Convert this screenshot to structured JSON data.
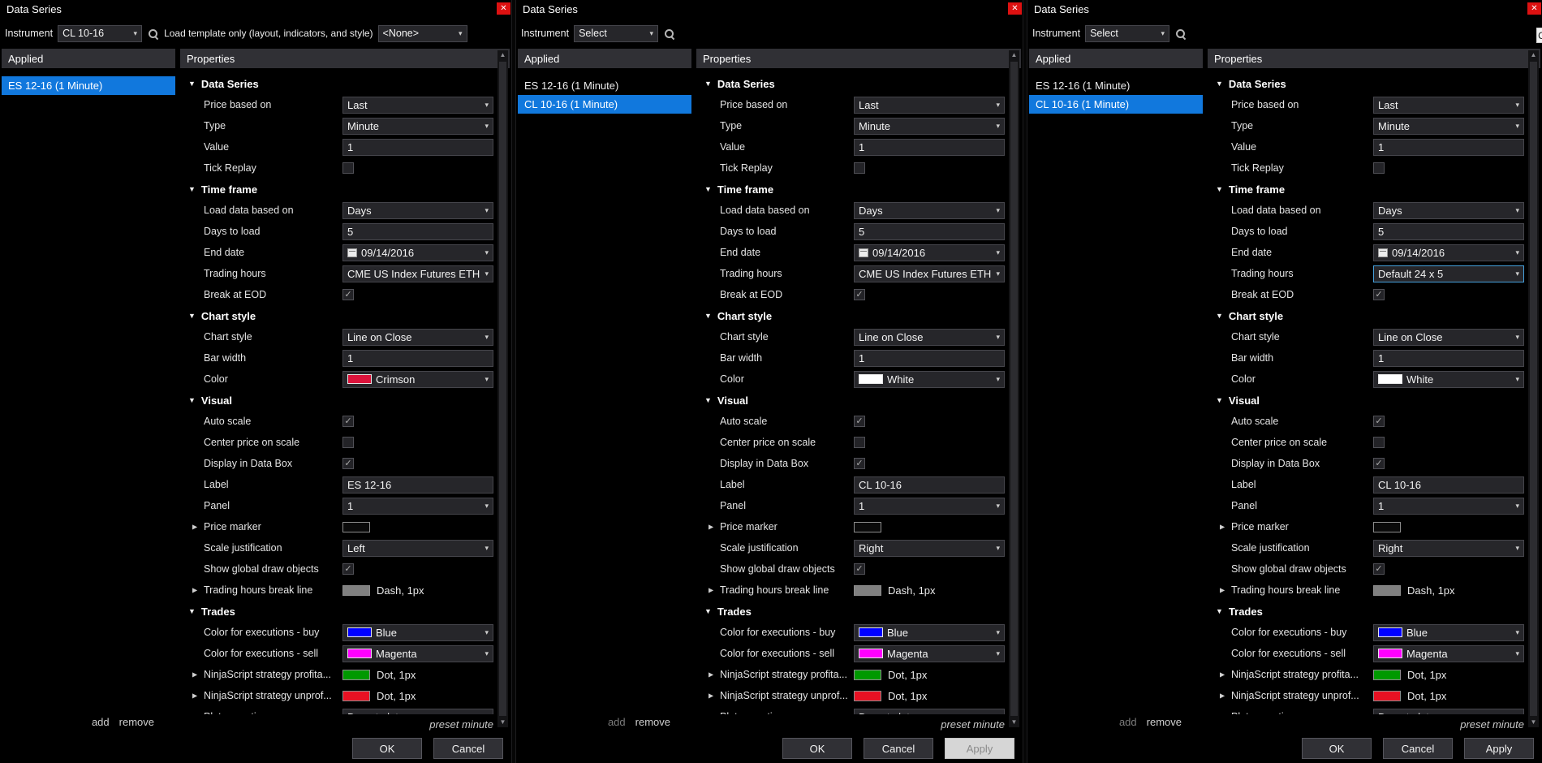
{
  "ui": {
    "close_glyph": "✕",
    "chevron": "▾",
    "category_arrow": "▼",
    "expand_arrow": "▶",
    "check_glyph": "✓",
    "arrow_up": "▲",
    "arrow_down": "▼"
  },
  "fragment": {
    "label": "C"
  },
  "dialogs": [
    {
      "title": "Data Series",
      "toolbar": {
        "instrument_label": "Instrument",
        "instrument_value": "CL 10-16",
        "template_label": "Load template only (layout, indicators, and style)",
        "template_value": "<None>"
      },
      "applied_header": "Applied",
      "applied_items": [
        {
          "label": "ES 12-16 (1 Minute)",
          "selected": true
        }
      ],
      "properties_header": "Properties",
      "groups": [
        {
          "label": "Data Series",
          "rows": [
            {
              "label": "Price based on",
              "type": "select",
              "value": "Last"
            },
            {
              "label": "Type",
              "type": "select",
              "value": "Minute"
            },
            {
              "label": "Value",
              "type": "input",
              "value": "1"
            },
            {
              "label": "Tick Replay",
              "type": "checkbox",
              "checked": false
            }
          ]
        },
        {
          "label": "Time frame",
          "rows": [
            {
              "label": "Load data based on",
              "type": "select",
              "value": "Days"
            },
            {
              "label": "Days to load",
              "type": "input",
              "value": "5"
            },
            {
              "label": "End date",
              "type": "date",
              "value": "09/14/2016"
            },
            {
              "label": "Trading hours",
              "type": "select",
              "value": "CME US Index Futures ETH"
            },
            {
              "label": "Break at EOD",
              "type": "checkbox",
              "checked": true
            }
          ]
        },
        {
          "label": "Chart style",
          "rows": [
            {
              "label": "Chart style",
              "type": "select",
              "value": "Line on Close"
            },
            {
              "label": "Bar width",
              "type": "input",
              "value": "1"
            },
            {
              "label": "Color",
              "type": "colorselect",
              "value": "Crimson",
              "color": "#DC143C"
            }
          ]
        },
        {
          "label": "Visual",
          "rows": [
            {
              "label": "Auto scale",
              "type": "checkbox",
              "checked": true
            },
            {
              "label": "Center price on scale",
              "type": "checkbox",
              "checked": false
            },
            {
              "label": "Display in Data Box",
              "type": "checkbox",
              "checked": true
            },
            {
              "label": "Label",
              "type": "input",
              "value": "ES 12-16"
            },
            {
              "label": "Panel",
              "type": "select",
              "value": "1"
            },
            {
              "label": "Price marker",
              "type": "swatch",
              "color": "#0a0a0a",
              "expandable": true
            },
            {
              "label": "Scale justification",
              "type": "select",
              "value": "Left"
            },
            {
              "label": "Show global draw objects",
              "type": "checkbox",
              "checked": true
            },
            {
              "label": "Trading hours break line",
              "type": "lineswatch",
              "value": "Dash, 1px",
              "color": "#808080",
              "expandable": true
            }
          ]
        },
        {
          "label": "Trades",
          "rows": [
            {
              "label": "Color for executions - buy",
              "type": "colorselect",
              "value": "Blue",
              "color": "#0000FF"
            },
            {
              "label": "Color for executions - sell",
              "type": "colorselect",
              "value": "Magenta",
              "color": "#FF00FF"
            },
            {
              "label": "NinjaScript strategy profita...",
              "type": "lineswatch",
              "value": "Dot, 1px",
              "color": "#009900",
              "expandable": true
            },
            {
              "label": "NinjaScript strategy unprof...",
              "type": "lineswatch",
              "value": "Dot, 1px",
              "color": "#E81123",
              "expandable": true
            },
            {
              "label": "Plot executions",
              "type": "select",
              "value": "Do not plot"
            }
          ]
        }
      ],
      "footer": {
        "add": "add",
        "remove": "remove",
        "add_enabled": true,
        "preset": "preset minute"
      },
      "buttons": [
        {
          "label": "OK",
          "disabled": false
        },
        {
          "label": "Cancel",
          "disabled": false
        }
      ]
    },
    {
      "title": "Data Series",
      "toolbar": {
        "instrument_label": "Instrument",
        "instrument_value": "Select"
      },
      "applied_header": "Applied",
      "applied_items": [
        {
          "label": "ES 12-16 (1 Minute)",
          "selected": false
        },
        {
          "label": "CL 10-16 (1 Minute)",
          "selected": true
        }
      ],
      "properties_header": "Properties",
      "groups": [
        {
          "label": "Data Series",
          "rows": [
            {
              "label": "Price based on",
              "type": "select",
              "value": "Last"
            },
            {
              "label": "Type",
              "type": "select",
              "value": "Minute"
            },
            {
              "label": "Value",
              "type": "input",
              "value": "1"
            },
            {
              "label": "Tick Replay",
              "type": "checkbox",
              "checked": false
            }
          ]
        },
        {
          "label": "Time frame",
          "rows": [
            {
              "label": "Load data based on",
              "type": "select",
              "value": "Days"
            },
            {
              "label": "Days to load",
              "type": "input",
              "value": "5"
            },
            {
              "label": "End date",
              "type": "date",
              "value": "09/14/2016"
            },
            {
              "label": "Trading hours",
              "type": "select",
              "value": "CME US Index Futures ETH"
            },
            {
              "label": "Break at EOD",
              "type": "checkbox",
              "checked": true
            }
          ]
        },
        {
          "label": "Chart style",
          "rows": [
            {
              "label": "Chart style",
              "type": "select",
              "value": "Line on Close"
            },
            {
              "label": "Bar width",
              "type": "input",
              "value": "1"
            },
            {
              "label": "Color",
              "type": "colorselect",
              "value": "White",
              "color": "#FFFFFF"
            }
          ]
        },
        {
          "label": "Visual",
          "rows": [
            {
              "label": "Auto scale",
              "type": "checkbox",
              "checked": true
            },
            {
              "label": "Center price on scale",
              "type": "checkbox",
              "checked": false
            },
            {
              "label": "Display in Data Box",
              "type": "checkbox",
              "checked": true
            },
            {
              "label": "Label",
              "type": "input",
              "value": "CL 10-16"
            },
            {
              "label": "Panel",
              "type": "select",
              "value": "1"
            },
            {
              "label": "Price marker",
              "type": "swatch",
              "color": "#0a0a0a",
              "expandable": true
            },
            {
              "label": "Scale justification",
              "type": "select",
              "value": "Right"
            },
            {
              "label": "Show global draw objects",
              "type": "checkbox",
              "checked": true
            },
            {
              "label": "Trading hours break line",
              "type": "lineswatch",
              "value": "Dash, 1px",
              "color": "#808080",
              "expandable": true
            }
          ]
        },
        {
          "label": "Trades",
          "rows": [
            {
              "label": "Color for executions - buy",
              "type": "colorselect",
              "value": "Blue",
              "color": "#0000FF"
            },
            {
              "label": "Color for executions - sell",
              "type": "colorselect",
              "value": "Magenta",
              "color": "#FF00FF"
            },
            {
              "label": "NinjaScript strategy profita...",
              "type": "lineswatch",
              "value": "Dot, 1px",
              "color": "#009900",
              "expandable": true
            },
            {
              "label": "NinjaScript strategy unprof...",
              "type": "lineswatch",
              "value": "Dot, 1px",
              "color": "#E81123",
              "expandable": true
            },
            {
              "label": "Plot executions",
              "type": "select",
              "value": "Do not plot"
            }
          ]
        }
      ],
      "footer": {
        "add": "add",
        "remove": "remove",
        "add_enabled": false,
        "preset": "preset minute"
      },
      "buttons": [
        {
          "label": "OK",
          "disabled": false
        },
        {
          "label": "Cancel",
          "disabled": false
        },
        {
          "label": "Apply",
          "disabled": true
        }
      ]
    },
    {
      "title": "Data Series",
      "toolbar": {
        "instrument_label": "Instrument",
        "instrument_value": "Select"
      },
      "applied_header": "Applied",
      "applied_items": [
        {
          "label": "ES 12-16 (1 Minute)",
          "selected": false
        },
        {
          "label": "CL 10-16 (1 Minute)",
          "selected": true
        }
      ],
      "properties_header": "Properties",
      "groups": [
        {
          "label": "Data Series",
          "rows": [
            {
              "label": "Price based on",
              "type": "select",
              "value": "Last"
            },
            {
              "label": "Type",
              "type": "select",
              "value": "Minute"
            },
            {
              "label": "Value",
              "type": "input",
              "value": "1"
            },
            {
              "label": "Tick Replay",
              "type": "checkbox",
              "checked": false
            }
          ]
        },
        {
          "label": "Time frame",
          "rows": [
            {
              "label": "Load data based on",
              "type": "select",
              "value": "Days"
            },
            {
              "label": "Days to load",
              "type": "input",
              "value": "5"
            },
            {
              "label": "End date",
              "type": "date",
              "value": "09/14/2016"
            },
            {
              "label": "Trading hours",
              "type": "select",
              "value": "Default 24 x 5",
              "focused": true
            },
            {
              "label": "Break at EOD",
              "type": "checkbox",
              "checked": true
            }
          ]
        },
        {
          "label": "Chart style",
          "rows": [
            {
              "label": "Chart style",
              "type": "select",
              "value": "Line on Close"
            },
            {
              "label": "Bar width",
              "type": "input",
              "value": "1"
            },
            {
              "label": "Color",
              "type": "colorselect",
              "value": "White",
              "color": "#FFFFFF"
            }
          ]
        },
        {
          "label": "Visual",
          "rows": [
            {
              "label": "Auto scale",
              "type": "checkbox",
              "checked": true
            },
            {
              "label": "Center price on scale",
              "type": "checkbox",
              "checked": false
            },
            {
              "label": "Display in Data Box",
              "type": "checkbox",
              "checked": true
            },
            {
              "label": "Label",
              "type": "input",
              "value": "CL 10-16"
            },
            {
              "label": "Panel",
              "type": "select",
              "value": "1"
            },
            {
              "label": "Price marker",
              "type": "swatch",
              "color": "#0a0a0a",
              "expandable": true
            },
            {
              "label": "Scale justification",
              "type": "select",
              "value": "Right"
            },
            {
              "label": "Show global draw objects",
              "type": "checkbox",
              "checked": true
            },
            {
              "label": "Trading hours break line",
              "type": "lineswatch",
              "value": "Dash, 1px",
              "color": "#808080",
              "expandable": true
            }
          ]
        },
        {
          "label": "Trades",
          "rows": [
            {
              "label": "Color for executions - buy",
              "type": "colorselect",
              "value": "Blue",
              "color": "#0000FF"
            },
            {
              "label": "Color for executions - sell",
              "type": "colorselect",
              "value": "Magenta",
              "color": "#FF00FF"
            },
            {
              "label": "NinjaScript strategy profita...",
              "type": "lineswatch",
              "value": "Dot, 1px",
              "color": "#009900",
              "expandable": true
            },
            {
              "label": "NinjaScript strategy unprof...",
              "type": "lineswatch",
              "value": "Dot, 1px",
              "color": "#E81123",
              "expandable": true
            },
            {
              "label": "Plot executions",
              "type": "select",
              "value": "Do not plot"
            }
          ]
        }
      ],
      "footer": {
        "add": "add",
        "remove": "remove",
        "add_enabled": false,
        "preset": "preset minute"
      },
      "buttons": [
        {
          "label": "OK",
          "disabled": false
        },
        {
          "label": "Cancel",
          "disabled": false
        },
        {
          "label": "Apply",
          "disabled": false
        }
      ]
    }
  ]
}
